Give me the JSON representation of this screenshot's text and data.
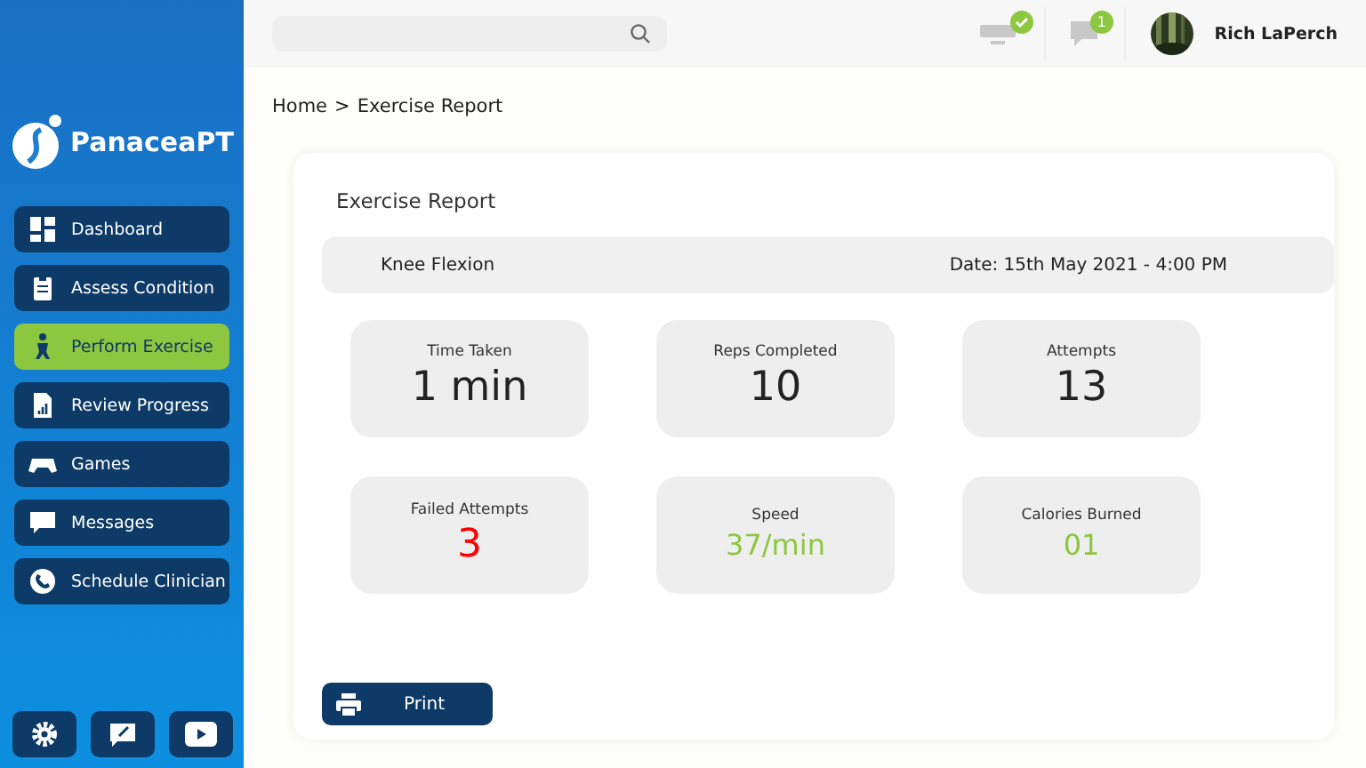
{
  "brand": {
    "name": "PanaceaPT"
  },
  "nav": [
    {
      "label": "Dashboard",
      "selected": false
    },
    {
      "label": "Assess Condition",
      "selected": false
    },
    {
      "label": "Perform Exercise",
      "selected": true
    },
    {
      "label": "Review Progress",
      "selected": false
    },
    {
      "label": "Games",
      "selected": false
    },
    {
      "label": "Messages",
      "selected": false
    },
    {
      "label": "Schedule Clinician",
      "selected": false
    }
  ],
  "topbar": {
    "device_connected": true,
    "message_count": "1",
    "user_name": "Rich LaPerch"
  },
  "breadcrumb": [
    "Home",
    ">",
    "Exercise Report"
  ],
  "report": {
    "title": "Exercise Report",
    "exercise": "Knee Flexion",
    "date": "Date: 15th May 2021 - 4:00 PM",
    "stats": [
      {
        "label": "Time Taken",
        "value": "1 min",
        "color": "#222222"
      },
      {
        "label": "Reps Completed",
        "value": "10",
        "color": "#222222"
      },
      {
        "label": "Attempts",
        "value": "13",
        "color": "#222222"
      },
      {
        "label": "Failed Attempts",
        "value": "3",
        "color": "#ff0000"
      },
      {
        "label": "Speed",
        "value": "37/min",
        "color": "#8dc63f"
      },
      {
        "label": "Calories Burned",
        "value": "01",
        "color": "#8dc63f"
      }
    ],
    "print_label": "Print"
  }
}
